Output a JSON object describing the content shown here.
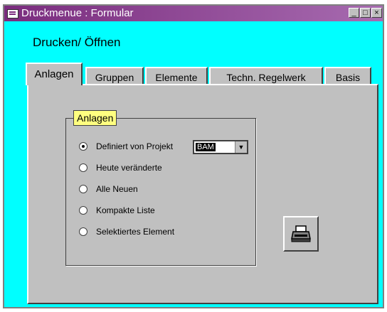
{
  "window": {
    "title": "Druckmenue : Formular",
    "minimize_label": "_",
    "maximize_label": "□",
    "close_label": "×"
  },
  "heading": "Drucken/ Öffnen",
  "tabs": [
    {
      "label": "Anlagen",
      "active": true
    },
    {
      "label": "Gruppen",
      "active": false
    },
    {
      "label": "Elemente",
      "active": false
    },
    {
      "label": "Techn. Regelwerk",
      "active": false
    },
    {
      "label": "Basis",
      "active": false
    }
  ],
  "group": {
    "label": "Anlagen",
    "options": [
      {
        "label": "Definiert von Projekt",
        "selected": true
      },
      {
        "label": "Heute veränderte",
        "selected": false
      },
      {
        "label": "Alle Neuen",
        "selected": false
      },
      {
        "label": "Kompakte Liste",
        "selected": false
      },
      {
        "label": "Selektiertes Element",
        "selected": false
      }
    ],
    "project_select": {
      "value": "BAM",
      "arrow": "▼"
    }
  },
  "print_button": {
    "icon": "printer-icon"
  },
  "colors": {
    "form_background": "#00ffff",
    "title_bar": "#7a2c7e",
    "panel": "#c0c0c0",
    "group_label_bg": "#ffff80"
  }
}
